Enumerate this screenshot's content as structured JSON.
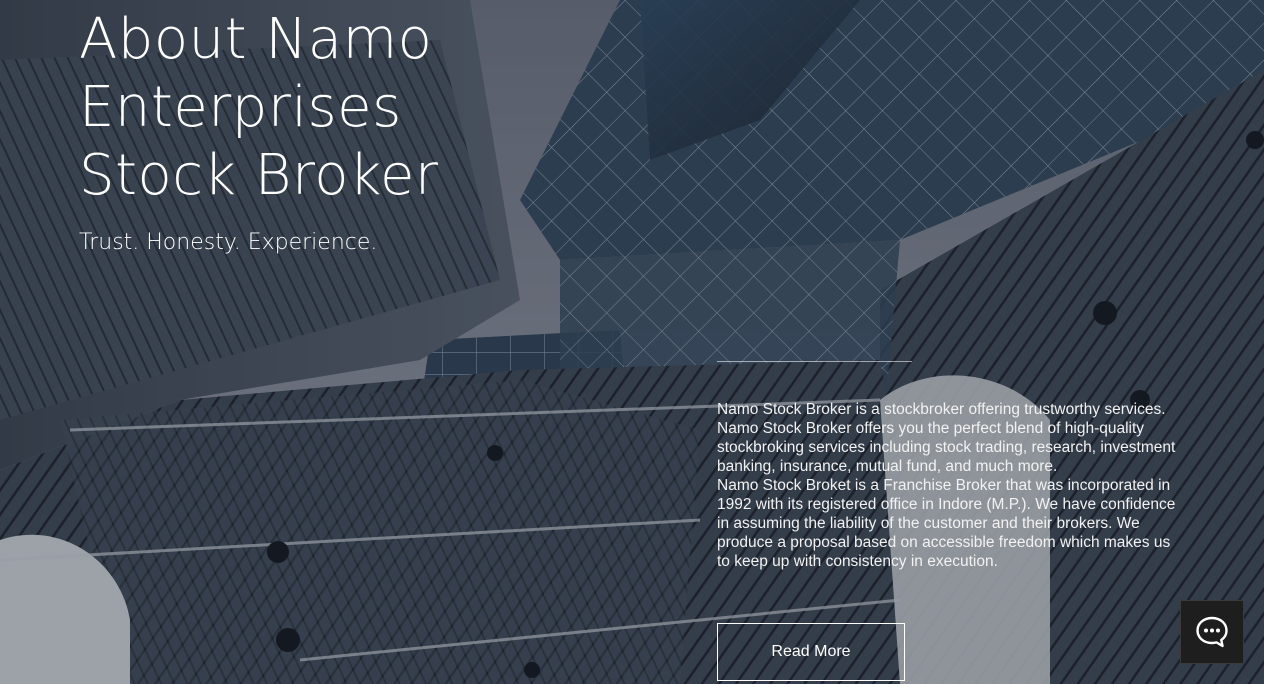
{
  "hero": {
    "title_lines": [
      "About Namo",
      "Enterprises",
      "Stock Broker"
    ],
    "tagline": "Trust. Honesty. Experience.",
    "paragraphs": [
      "Namo Stock Broker is a stockbroker offering trustworthy services. Namo Stock Broker offers you the perfect blend of high-quality stockbroking services including stock trading, research, investment banking, insurance, mutual fund, and much more.",
      "Namo Stock Broket is a Franchise Broker that was incorporated in 1992 with its registered office in Indore (M.P.). We have confidence in assuming the liability of the customer and their brokers. We produce a proposal based on accessible freedom which makes us to keep up with consistency in execution."
    ],
    "read_more_label": "Read More"
  },
  "chat": {
    "icon": "chat-bubble-icon"
  },
  "colors": {
    "overlay": "#1c202a",
    "sky": "#7d8594",
    "glass": "#2c3e52",
    "text": "#ffffff",
    "chat_bg": "#1e1e1e"
  }
}
